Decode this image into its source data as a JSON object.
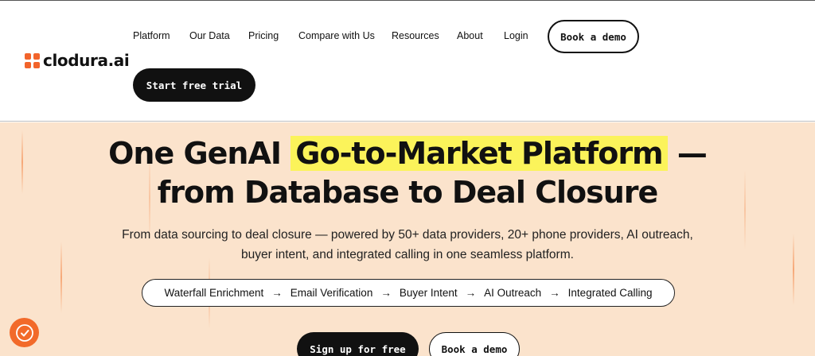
{
  "brand": {
    "name": "clodura.ai",
    "color": "#f2642b"
  },
  "nav": {
    "items": [
      {
        "label": "Platform"
      },
      {
        "label": "Our Data"
      },
      {
        "label": "Pricing"
      },
      {
        "label": "Compare with Us"
      },
      {
        "label": "Resources"
      },
      {
        "label": "About"
      },
      {
        "label": "Login"
      }
    ],
    "book_demo": "Book a demo",
    "free_trial": "Start free trial"
  },
  "hero": {
    "title_line1_highlight": "Go-to-Market Platform",
    "title_line1_prefix": "One GenAI ",
    "title_line1_suffix": " —",
    "title_line2": "from Database to Deal Closure",
    "subtitle_line1": "From data sourcing to deal closure — powered by 50+ data providers, 20+ phone providers, AI outreach,",
    "subtitle_line2": "buyer intent, and integrated calling in one seamless platform.",
    "steps": [
      "Waterfall Enrichment",
      "Email Verification",
      "Buyer Intent",
      "AI Outreach",
      "Integrated Calling"
    ],
    "arrow": "→",
    "signup": "Sign up for free",
    "book_demo": "Book a demo",
    "highlight_color": "#fbf35a",
    "background_color": "#fbe3cc"
  },
  "help_widget": {
    "icon": "help-hand-icon",
    "color": "#f26a2a"
  }
}
